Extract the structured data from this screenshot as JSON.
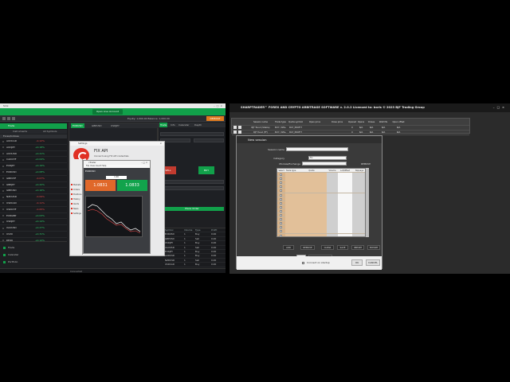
{
  "left": {
    "window_title": "Sirix",
    "center_button": "Open Live Account",
    "toolbar_text": "Equity: 1,000.00   Balance: 1,000.00",
    "orange_button": "DEPOSIT",
    "side_header": "Trade",
    "side_tabs": [
      "Instruments",
      "All Symbols"
    ],
    "watchlist_title": "Forex/Indices",
    "watchlist": [
      {
        "sym": "AUDCAD",
        "chg": "-0.12%",
        "dir": "dn"
      },
      {
        "sym": "AUDJPY",
        "chg": "+0.18%",
        "dir": "up"
      },
      {
        "sym": "AUDUSD",
        "chg": "+0.21%",
        "dir": "up"
      },
      {
        "sym": "CADCHF",
        "chg": "+0.04%",
        "dir": "up"
      },
      {
        "sym": "EURJPY",
        "chg": "+0.19%",
        "dir": "up"
      },
      {
        "sym": "EURUSD",
        "chg": "+0.08%",
        "dir": "up"
      },
      {
        "sym": "GBPCHF",
        "chg": "-0.07%",
        "dir": "dn"
      },
      {
        "sym": "GBPJPY",
        "chg": "+0.22%",
        "dir": "up"
      },
      {
        "sym": "GBPUSD",
        "chg": "+0.16%",
        "dir": "up"
      },
      {
        "sym": "NZDUSD",
        "chg": "-0.09%",
        "dir": "dn"
      },
      {
        "sym": "USDCAD",
        "chg": "-0.11%",
        "dir": "dn"
      },
      {
        "sym": "USDCHF",
        "chg": "-0.05%",
        "dir": "dn"
      },
      {
        "sym": "EURGBP",
        "chg": "+0.03%",
        "dir": "up"
      },
      {
        "sym": "USDJPY",
        "chg": "+0.14%",
        "dir": "up"
      },
      {
        "sym": "XAUUSD",
        "chg": "+0.27%",
        "dir": "up"
      },
      {
        "sym": "US30",
        "chg": "+0.31%",
        "dir": "up"
      },
      {
        "sym": "DE40",
        "chg": "+0.12%",
        "dir": "up"
      }
    ],
    "side_bottom": [
      "Trade",
      "Calendar",
      "Portfolio"
    ],
    "chart_tabs": [
      "EURUSD",
      "GBPUSD",
      "USDJPY"
    ],
    "trade_tabs": [
      "Trade",
      "Info",
      "Calendar",
      "Depth"
    ],
    "trade_sell": "SELL",
    "trade_buy": "BUY",
    "trade_place": "Place Order",
    "positions_head": [
      "Symbol",
      "Volume",
      "Type",
      "Profit"
    ],
    "positions": [
      [
        "EURUSD",
        "1",
        "Buy",
        "0.00"
      ],
      [
        "GBPUSD",
        "1",
        "Sell",
        "0.00"
      ],
      [
        "USDJPY",
        "1",
        "Buy",
        "0.00"
      ],
      [
        "XAUUSD",
        "1",
        "Sell",
        "0.00"
      ],
      [
        "EURJPY",
        "1",
        "Buy",
        "0.00"
      ],
      [
        "AUDUSD",
        "1",
        "Buy",
        "0.00"
      ],
      [
        "NZDUSD",
        "1",
        "Sell",
        "0.00"
      ],
      [
        "USDCAD",
        "1",
        "Buy",
        "0.00"
      ]
    ],
    "fixapi_title": "Settings",
    "fixapi_heading": "FIX API",
    "fixapi_text": "Connect using FIX API credentials",
    "fixapi_link": "Create account",
    "chart_dialog_title": "cTrader",
    "chart_dialog_menu": "File   View   Insert   Help",
    "chart_symbol": "EURUSD",
    "qty": "1.00",
    "dc_sell": "1.0831",
    "dc_buy": "1.0833",
    "dlg_side_items": [
      "Markets",
      "Orders",
      "Positions",
      "History",
      "Alerts",
      "News",
      "Settings"
    ],
    "status_text": "Connected"
  },
  "right": {
    "window_title": "SHARPTRADER™ FOREX AND CRYPTO ARBITRAGE SOFTWARE v. 2.0.2 Licensed to: boris © 2023 BJF Trading Group",
    "table_head": [
      "Session name",
      "Trade type",
      "Quote symbol",
      "Open price",
      "Close price",
      "Opened",
      "Opens",
      "Closes",
      "Wait Ms",
      "Open offset"
    ],
    "table_rows": [
      [
        "BJF Trend (Stable)",
        "BUY / SELL",
        "BUY_PROFIT",
        "",
        "",
        "0",
        "N/A",
        "N/A",
        "N/A",
        "N/A"
      ],
      [
        "BJF Trend (FF)",
        "BUY / SELL",
        "BUY_PROFIT",
        "",
        "",
        "0",
        "N/A",
        "N/A",
        "N/A",
        "N/A"
      ]
    ],
    "session_title": "New session",
    "session_name_label": "Session name",
    "session_name_value": "",
    "category_label": "Category",
    "category_value": "Fix",
    "module_label": "Module/Exchange",
    "module_value": "",
    "remove_top": "REMOVE",
    "grid_head": [
      "Select",
      "Trade type",
      "Quote",
      "Volume",
      "Lot/Offset",
      "Slippage"
    ],
    "grid_rows": 17,
    "buttons": [
      "ADD",
      "REMOVE",
      "CLEAR",
      "SAVE",
      "IMPORT",
      "EXPORT"
    ],
    "suffix_label": "Suffix",
    "create_new": "CREATE NEW",
    "startup_label": "Connect on startup",
    "ok": "OK",
    "cancel": "CANCEL"
  }
}
